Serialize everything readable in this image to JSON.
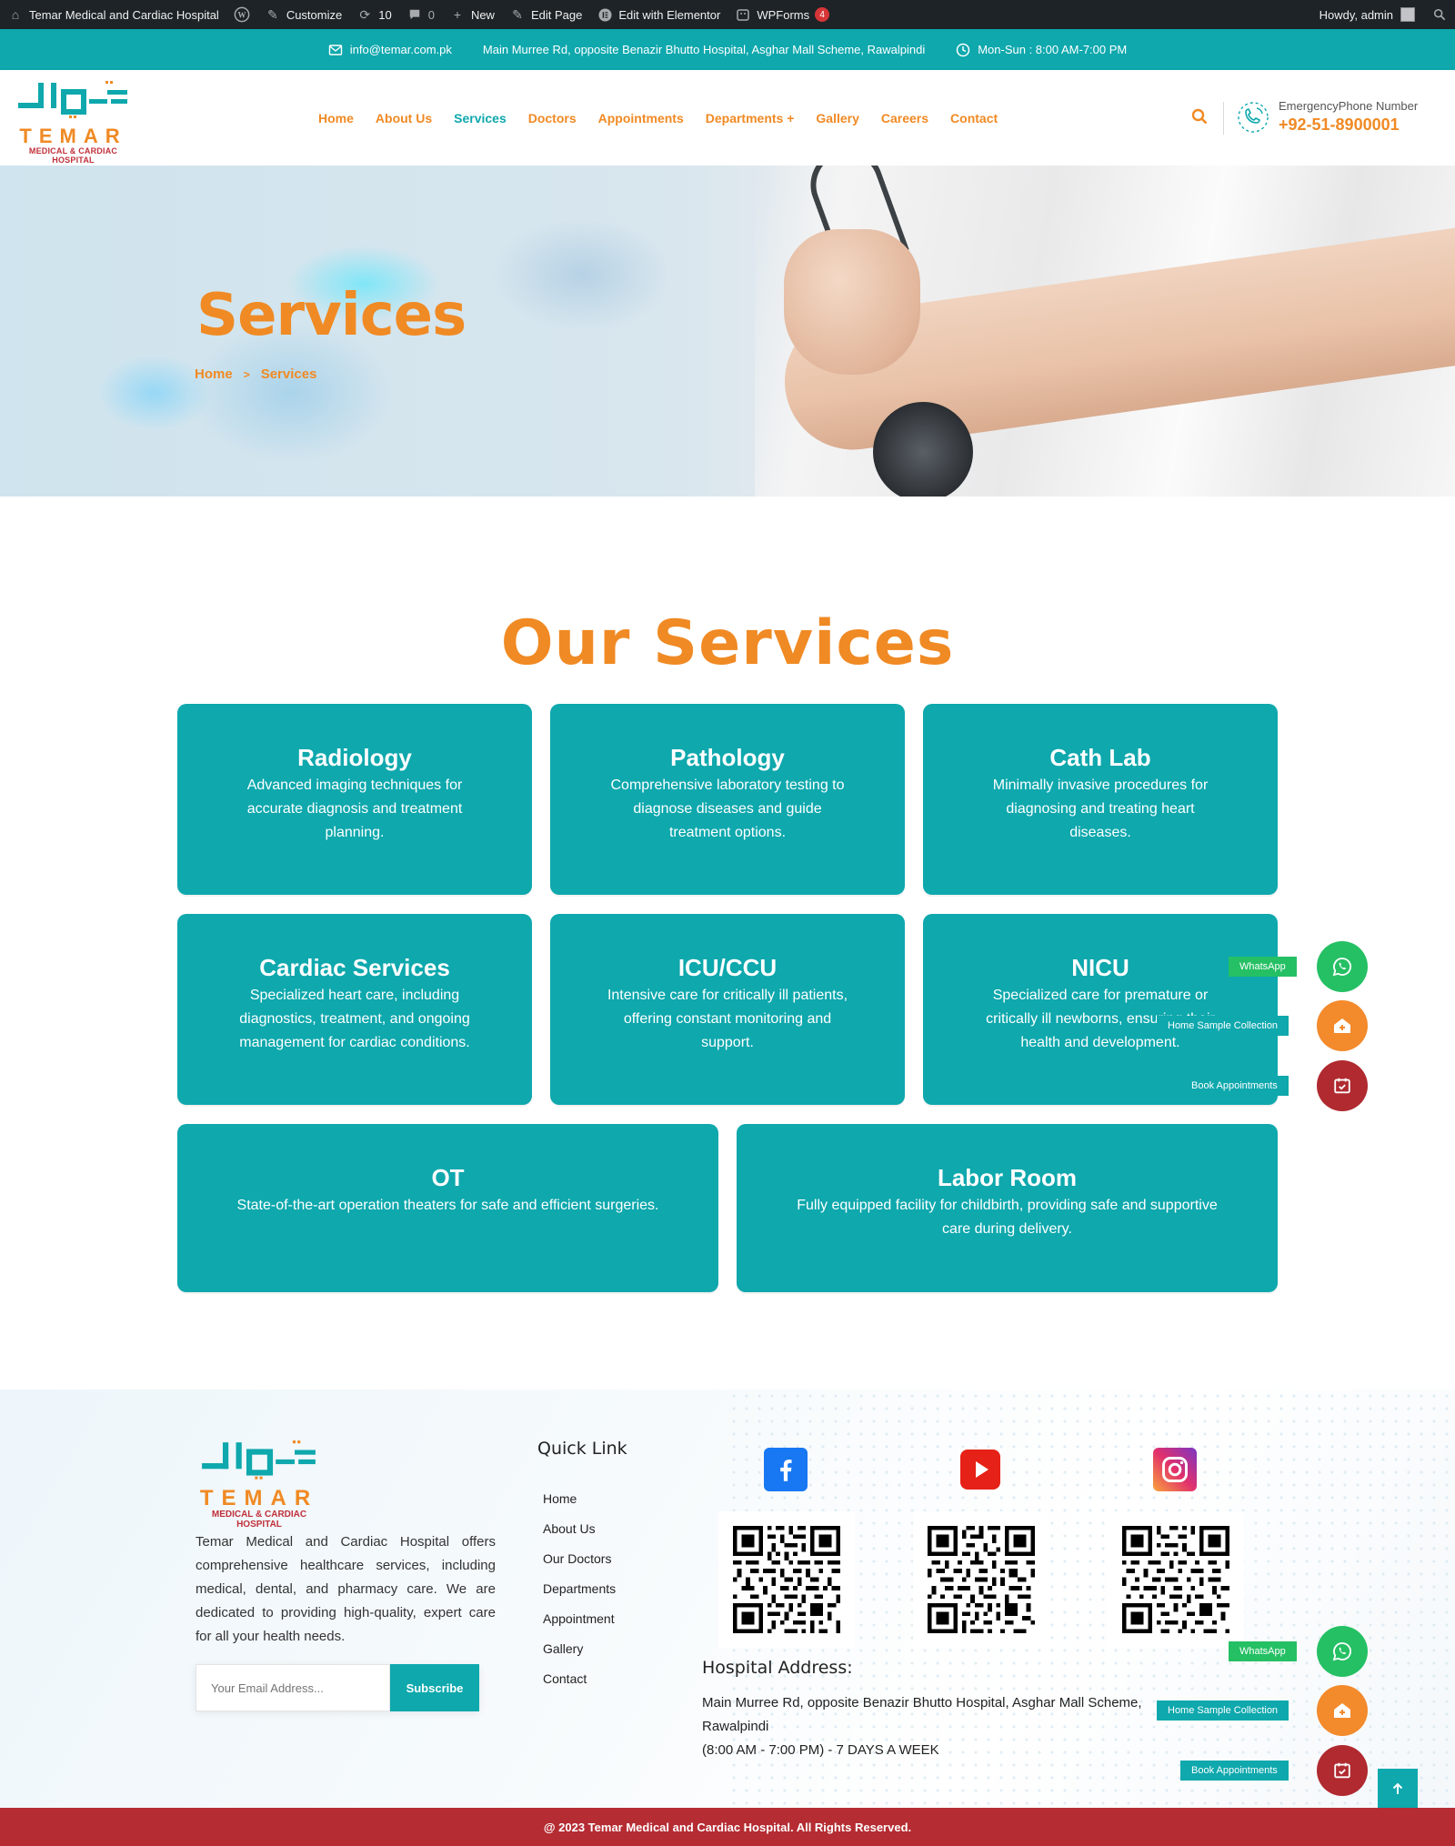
{
  "adminbar": {
    "site_name": "Temar Medical and Cardiac Hospital",
    "customize": "Customize",
    "updates_count": "10",
    "comments_count": "0",
    "new": "New",
    "edit_page": "Edit Page",
    "edit_elementor": "Edit with Elementor",
    "wpforms": "WPForms",
    "wpforms_badge": "4",
    "howdy": "Howdy, admin"
  },
  "infobar": {
    "email": "info@temar.com.pk",
    "address": "Main Murree Rd, opposite Benazir Bhutto Hospital, Asghar Mall Scheme, Rawalpindi",
    "hours": "Mon-Sun : 8:00 AM-7:00 PM"
  },
  "logo": {
    "word": "TEMAR",
    "subtitle": "MEDICAL & CARDIAC HOSPITAL"
  },
  "nav": {
    "items": [
      "Home",
      "About Us",
      "Services",
      "Doctors",
      "Appointments",
      "Departments +",
      "Gallery",
      "Careers",
      "Contact"
    ],
    "active": "Services"
  },
  "emergency": {
    "label": "EmergencyPhone Number",
    "number": "+92-51-8900001"
  },
  "hero": {
    "title": "Services",
    "breadcrumb_home": "Home",
    "breadcrumb_sep": ">",
    "breadcrumb_current": "Services"
  },
  "services": {
    "heading": "Our Services",
    "items": [
      {
        "title": "Radiology",
        "desc": "Advanced imaging techniques for accurate diagnosis and treatment planning."
      },
      {
        "title": "Pathology",
        "desc": "Comprehensive laboratory testing to diagnose diseases and guide treatment options."
      },
      {
        "title": "Cath Lab",
        "desc": "Minimally invasive procedures for diagnosing and treating heart diseases."
      },
      {
        "title": "Cardiac Services",
        "desc": "Specialized heart care, including diagnostics, treatment, and ongoing management for cardiac conditions."
      },
      {
        "title": "ICU/CCU",
        "desc": "Intensive care for critically ill patients, offering constant monitoring and support."
      },
      {
        "title": "NICU",
        "desc": "Specialized care for premature or critically ill newborns, ensuring their health and development."
      },
      {
        "title": "OT",
        "desc": "State-of-the-art operation theaters for safe and efficient surgeries."
      },
      {
        "title": "Labor Room",
        "desc": "Fully equipped facility for childbirth, providing safe and supportive care during delivery."
      }
    ]
  },
  "floating": {
    "whatsapp": "WhatsApp",
    "home_sample": "Home Sample Collection",
    "book": "Book Appointments"
  },
  "footer": {
    "about": "Temar Medical and Cardiac Hospital offers comprehensive healthcare services, including medical, dental, and pharmacy care. We are dedicated to providing high-quality, expert care for all your health needs.",
    "email_placeholder": "Your Email Address...",
    "subscribe": "Subscribe",
    "quick_link_title": "Quick Link",
    "quick_links": [
      "Home",
      "About Us",
      "Our Doctors",
      "Departments",
      "Appointment",
      "Gallery",
      "Contact"
    ],
    "address_title": "Hospital Address:",
    "address_line1": "Main Murree Rd, opposite Benazir Bhutto Hospital, Asghar Mall Scheme,",
    "address_line2": "Rawalpindi",
    "address_line3": "(8:00 AM - 7:00 PM) - 7 DAYS A WEEK",
    "copyright": "@ 2023 Temar Medical and Cardiac Hospital. All Rights Reserved."
  },
  "colors": {
    "brand_teal": "#0ea8ad",
    "brand_orange": "#f08a24",
    "brand_red": "#b52c33",
    "whatsapp_green": "#25c064"
  }
}
